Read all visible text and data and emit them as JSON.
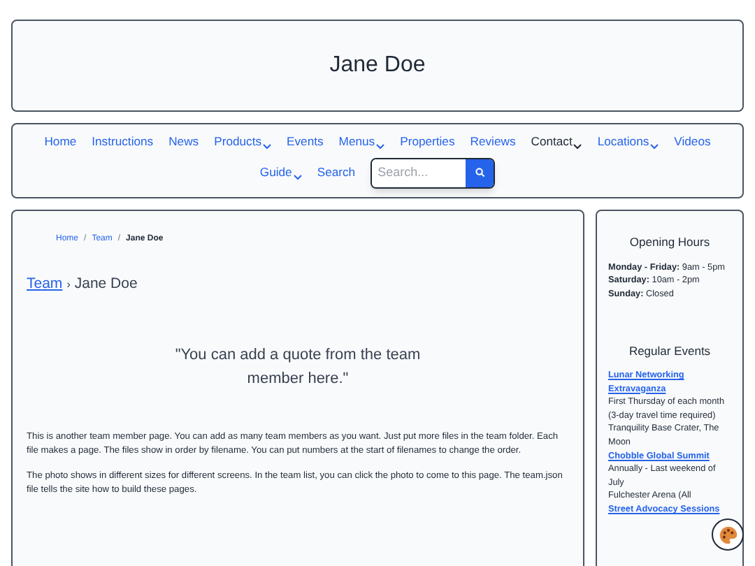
{
  "header": {
    "title": "Jane Doe"
  },
  "nav": {
    "items": [
      {
        "label": "Home",
        "dropdown": false,
        "selected": false
      },
      {
        "label": "Instructions",
        "dropdown": false,
        "selected": false
      },
      {
        "label": "News",
        "dropdown": false,
        "selected": false
      },
      {
        "label": "Products",
        "dropdown": true,
        "selected": false
      },
      {
        "label": "Events",
        "dropdown": false,
        "selected": false
      },
      {
        "label": "Menus",
        "dropdown": true,
        "selected": false
      },
      {
        "label": "Properties",
        "dropdown": false,
        "selected": false
      },
      {
        "label": "Reviews",
        "dropdown": false,
        "selected": false
      },
      {
        "label": "Contact",
        "dropdown": true,
        "selected": true
      },
      {
        "label": "Locations",
        "dropdown": true,
        "selected": false
      },
      {
        "label": "Videos",
        "dropdown": false,
        "selected": false
      },
      {
        "label": "Guide",
        "dropdown": true,
        "selected": false
      },
      {
        "label": "Search",
        "dropdown": false,
        "selected": false
      }
    ],
    "search": {
      "placeholder": "Search..."
    }
  },
  "main": {
    "breadcrumb": [
      "Home",
      "Team",
      "Jane Doe"
    ],
    "breadcrumb_separator": "/",
    "trail": {
      "link": "Team",
      "separator": "›",
      "current": "Jane Doe"
    },
    "quote": "\"You can add a quote from the team member here.\"",
    "paragraphs": [
      "This is another team member page. You can add as many team members as you want. Just put more files in the team folder. Each file makes a page. The files show in order by filename. You can put numbers at the start of filenames to change the order.",
      "The photo shows in different sizes for different screens. In the team list, you can click the photo to come to this page. The team.json file tells the site how to build these pages."
    ]
  },
  "sidebar": {
    "hours_title": "Opening Hours",
    "hours": [
      {
        "day": "Monday - Friday:",
        "time": "9am - 5pm"
      },
      {
        "day": "Saturday:",
        "time": "10am - 2pm"
      },
      {
        "day": "Sunday:",
        "time": "Closed"
      }
    ],
    "events_title": "Regular Events",
    "events": [
      {
        "name": "Lunar Networking Extravaganza",
        "when": "First Thursday of each month (3-day travel time required)",
        "where": "Tranquility Base Crater, The Moon"
      },
      {
        "name": "Chobble Global Summit",
        "when": "Annually - Last weekend of July",
        "where": "Fulchester Arena (All"
      },
      {
        "name": "Street Advocacy Sessions"
      }
    ]
  }
}
